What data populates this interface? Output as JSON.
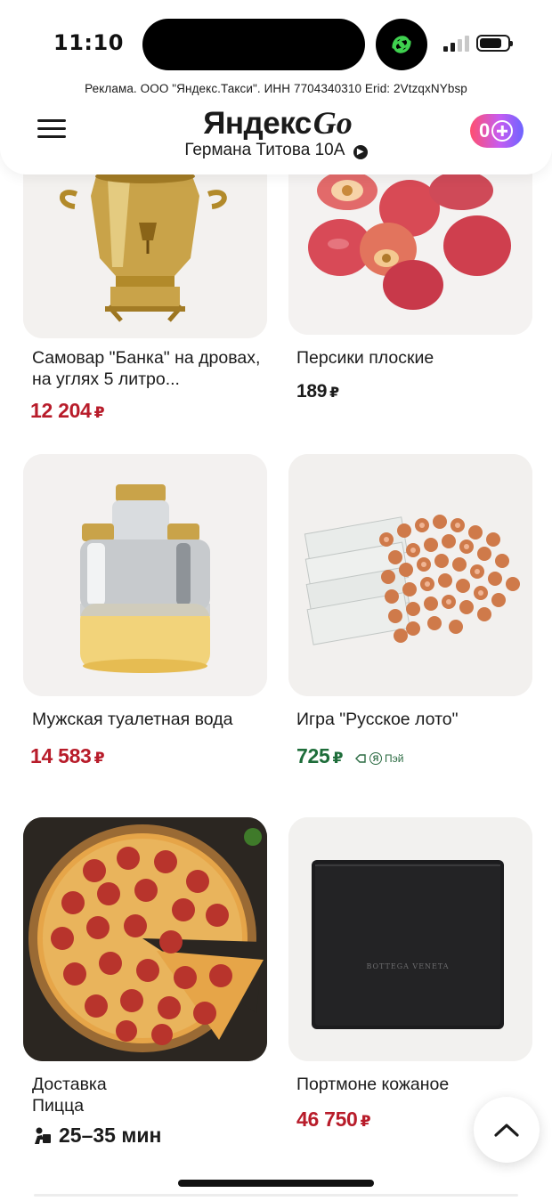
{
  "status_bar": {
    "time": "11:10"
  },
  "ad": {
    "text": "Реклама. ООО \"Яндекс.Такси\". ИНН 7704340310 Erid: 2VtzqxNYbsp"
  },
  "header": {
    "logo_text": "Яндекс",
    "logo_go": "Go",
    "address": "Германа Титова 10А",
    "plus_points": "0"
  },
  "products": [
    {
      "title": "Самовар \"Банка\" на дровах, на углях 5 литро...",
      "price": "12 204",
      "currency": "₽",
      "price_color": "#b81c2a"
    },
    {
      "title": "Персики плоские",
      "price": "189",
      "currency": "₽",
      "price_color": "#1b1b1b"
    },
    {
      "title": "Мужская туалетная вода",
      "price": "14 583",
      "currency": "₽",
      "price_color": "#b81c2a"
    },
    {
      "title": "Игра \"Русское лото\"",
      "price": "725",
      "currency": "₽",
      "price_color": "#1e6d3a",
      "pay_label": "Пэй",
      "pay_logo": "Я"
    },
    {
      "title": "Доставка\nПицца",
      "delivery_time": "25–35 мин"
    },
    {
      "title": "Портмоне кожаное",
      "price": "46 750",
      "currency": "₽",
      "price_color": "#b81c2a"
    }
  ],
  "icons": {
    "menu": "hamburger-icon",
    "address_arrow": "chevron-right-icon",
    "scroll_top": "chevron-up-icon",
    "courier": "courier-icon"
  },
  "colors": {
    "accent_red": "#b81c2a",
    "accent_green": "#1e6d3a",
    "app_icon_green": "#3fd14f"
  }
}
